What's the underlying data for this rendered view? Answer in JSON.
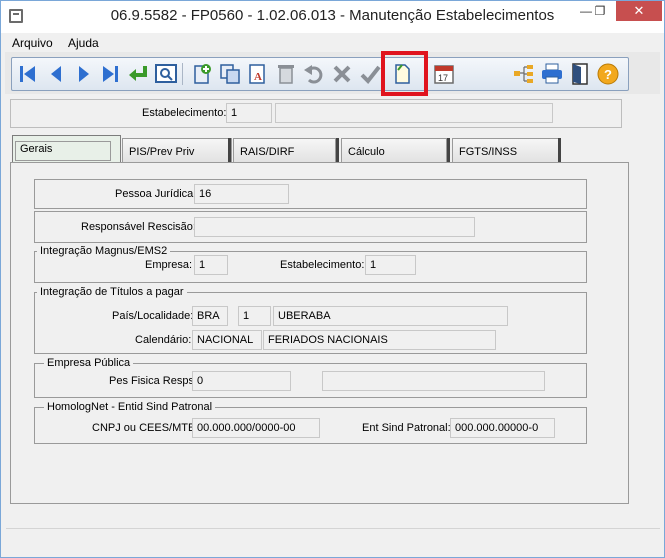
{
  "window": {
    "title": "06.9.5582 - FP0560 - 1.02.06.013 - Manutenção Estabelecimentos",
    "minimize": "—",
    "maximize": "❐",
    "close": "✕"
  },
  "menu": {
    "items": [
      {
        "label": "Arquivo"
      },
      {
        "label": "Ajuda"
      }
    ]
  },
  "toolbar": {
    "icons": [
      "first-icon",
      "prev-icon",
      "next-icon",
      "last-icon",
      "goto-icon",
      "search-icon",
      "add-icon",
      "copy-icon",
      "edit-icon",
      "delete-icon",
      "undo-icon",
      "cancel-icon",
      "confirm-icon",
      "new-document-icon",
      "calendar-icon",
      "tree-icon",
      "print-icon",
      "exit-icon",
      "help-icon"
    ],
    "calendar_day": "17"
  },
  "header": {
    "estab_label": "Estabelecimento:",
    "estab_value": "1",
    "estab_name": ""
  },
  "tabs": [
    {
      "label": "Gerais",
      "active": true
    },
    {
      "label": "PIS/Prev Priv"
    },
    {
      "label": "RAIS/DIRF"
    },
    {
      "label": "Cálculo"
    },
    {
      "label": "FGTS/INSS"
    }
  ],
  "gerais": {
    "pessoa_label": "Pessoa Jurídica:",
    "pessoa_value": "16",
    "resp_label": "Responsável Rescisão:",
    "resp_value": "",
    "magnus": {
      "title": "Integração Magnus/EMS2",
      "empresa_label": "Empresa:",
      "empresa_value": "1",
      "estab_label": "Estabelecimento:",
      "estab_value": "1"
    },
    "titulos": {
      "title": "Integração de Títulos a pagar",
      "pais_label": "País/Localidade:",
      "pais_value": "BRA",
      "loc_value": "1",
      "cidade_value": "UBERABA",
      "cal_label": "Calendário:",
      "cal_value": "NACIONAL",
      "cal_desc": "FERIADOS NACIONAIS"
    },
    "empresa_publica": {
      "title": "Empresa Pública",
      "pes_label": "Pes Fisica Resps:",
      "pes_value": "0",
      "pes_name": ""
    },
    "homolog": {
      "title": "HomologNet - Entid Sind Patronal",
      "cnpj_label": "CNPJ ou CEES/MTE:",
      "cnpj_value": "00.000.000/0000-00",
      "ent_label": "Ent Sind Patronal:",
      "ent_value": "000.000.00000-0"
    }
  },
  "colors": {
    "highlight": "#e0141e",
    "nav_blue": "#2e6fd0",
    "close_red": "#c74f4f"
  }
}
